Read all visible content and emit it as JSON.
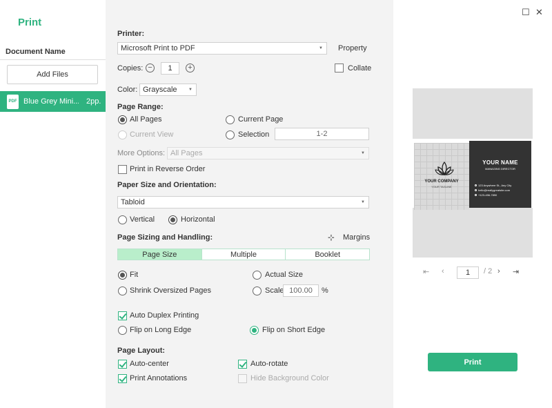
{
  "left": {
    "title": "Print",
    "doc_header": "Document Name",
    "add_files": "Add Files",
    "doc_item": {
      "icon": "PDF",
      "name": "Blue Grey Mini...",
      "pages": "2pp."
    }
  },
  "printer": {
    "label": "Printer:",
    "selected": "Microsoft Print to PDF",
    "property": "Property"
  },
  "copies": {
    "label": "Copies:",
    "minus": "−",
    "value": "1",
    "plus": "+",
    "collate": "Collate"
  },
  "color": {
    "label": "Color:",
    "selected": "Grayscale"
  },
  "page_range": {
    "label": "Page Range:",
    "all_pages": "All Pages",
    "current_page": "Current Page",
    "current_view": "Current View",
    "selection": "Selection",
    "selection_value": "1-2"
  },
  "more_options": {
    "label": "More Options:",
    "selected": "All Pages",
    "reverse": "Print in Reverse Order"
  },
  "paper": {
    "label": "Paper Size and Orientation:",
    "selected": "Tabloid",
    "vertical": "Vertical",
    "horizontal": "Horizontal"
  },
  "sizing": {
    "label": "Page Sizing and Handling:",
    "margins": "Margins",
    "tabs": [
      "Page Size",
      "Multiple",
      "Booklet"
    ],
    "fit": "Fit",
    "actual_size": "Actual Size",
    "shrink": "Shrink Oversized Pages",
    "scale": "Scale",
    "scale_value": "100.00",
    "percent": "%"
  },
  "duplex": {
    "auto": "Auto Duplex Printing",
    "long_edge": "Flip on Long Edge",
    "short_edge": "Flip on Short Edge"
  },
  "layout": {
    "label": "Page Layout:",
    "auto_center": "Auto-center",
    "auto_rotate": "Auto-rotate",
    "print_annotations": "Print Annotations",
    "hide_bg": "Hide Background Color"
  },
  "preview": {
    "company": "YOUR COMPANY",
    "tagline": "YOUR TAGLINE",
    "name": "YOUR NAME",
    "role": "MANAGING DIRECTOR",
    "address": "123 Anywhere St., Any City",
    "email": "hello@reallygreatsite.com",
    "phone": "+123-456-7890"
  },
  "pager": {
    "current": "1",
    "total": "/ 2"
  },
  "print_button": "Print",
  "colors": {
    "accent": "#2fb380",
    "tab_active": "#b9eecb",
    "panel": "#f3f3f3"
  }
}
